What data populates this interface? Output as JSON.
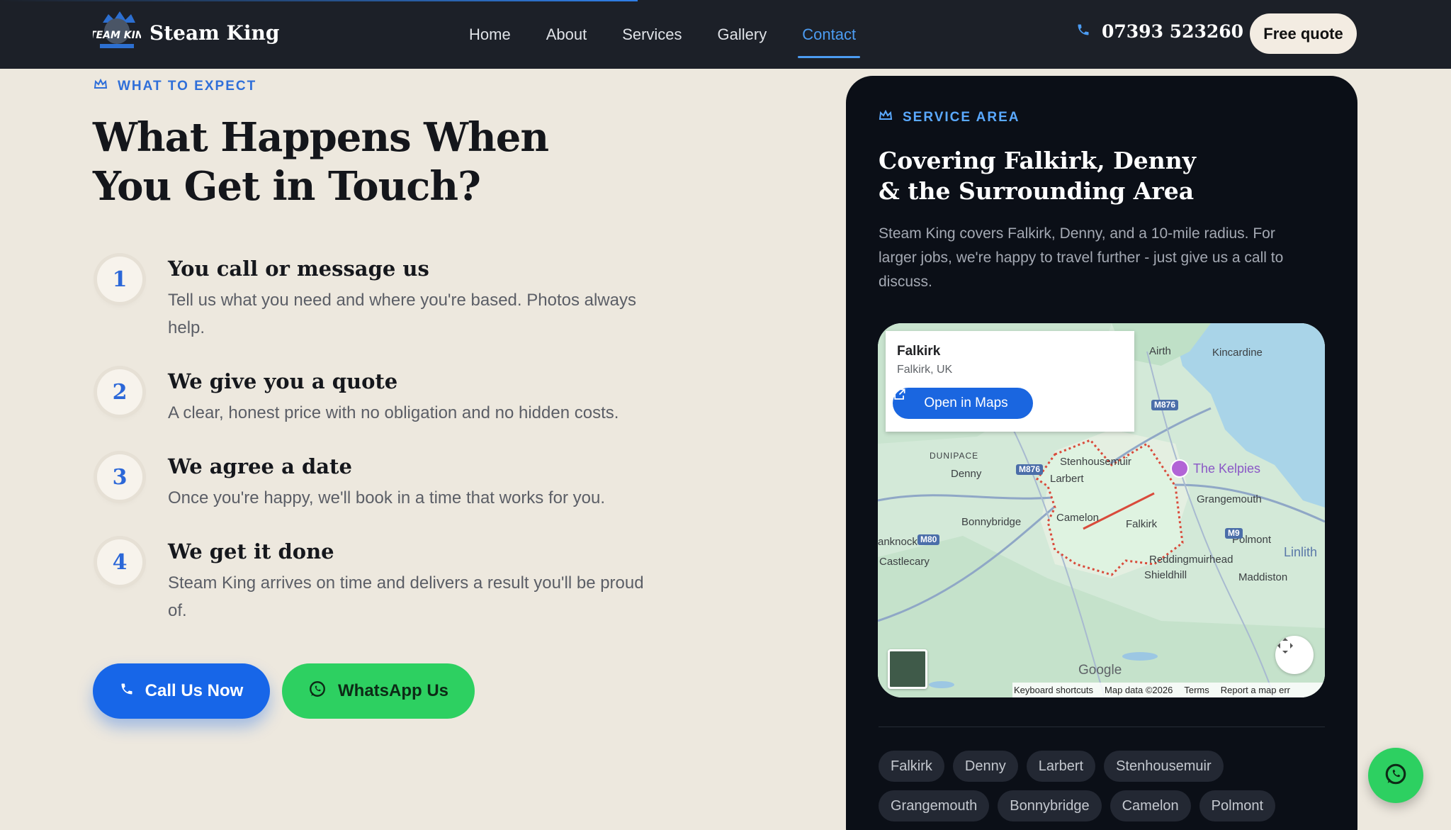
{
  "brand": {
    "name": "Steam King",
    "logo_text": "STEAM KING"
  },
  "nav": {
    "links": [
      "Home",
      "About",
      "Services",
      "Gallery",
      "Contact"
    ],
    "active": "Contact",
    "phone": "07393 523260",
    "quote_label": "Free quote"
  },
  "left": {
    "eyebrow": "WHAT TO EXPECT",
    "title_line1": "What Happens When",
    "title_line2": "You Get in Touch?",
    "steps": [
      {
        "num": "1",
        "title": "You call or message us",
        "desc": "Tell us what you need and where you're based. Photos always help."
      },
      {
        "num": "2",
        "title": "We give you a quote",
        "desc": "A clear, honest price with no obligation and no hidden costs."
      },
      {
        "num": "3",
        "title": "We agree a date",
        "desc": "Once you're happy, we'll book in a time that works for you."
      },
      {
        "num": "4",
        "title": "We get it done",
        "desc": "Steam King arrives on time and delivers a result you'll be proud of."
      }
    ],
    "call_label": "Call Us Now",
    "whatsapp_label": "WhatsApp Us"
  },
  "panel": {
    "eyebrow": "SERVICE AREA",
    "title_line1": "Covering Falkirk, Denny",
    "title_line2": "& the Surrounding Area",
    "desc": "Steam King covers Falkirk, Denny, and a 10-mile radius. For larger jobs, we're happy to travel further - just give us a call to discuss.",
    "map": {
      "place": "Falkirk",
      "place_sub": "Falkirk, UK",
      "open_label": "Open in Maps",
      "labels": [
        "Airth",
        "Kincardine",
        "DUNIPACE",
        "Denny",
        "Stenhousemuir",
        "Larbert",
        "Grangemouth",
        "Camelon",
        "Falkirk",
        "Bonnybridge",
        "Polmont",
        "anknock",
        "Castlecary",
        "Linlith",
        "Reddingmuirhead",
        "Shieldhill",
        "Maddiston"
      ],
      "roads": [
        "M876",
        "M876",
        "M80",
        "M9"
      ],
      "poi": "The Kelpies",
      "google": "Google",
      "attribution": [
        "Keyboard shortcuts",
        "Map data ©2026",
        "Terms",
        "Report a map err"
      ]
    },
    "chips": [
      "Falkirk",
      "Denny",
      "Larbert",
      "Stenhousemuir",
      "Grangemouth",
      "Bonnybridge",
      "Camelon",
      "Polmont"
    ]
  },
  "colors": {
    "accent_blue": "#1766e8",
    "whatsapp_green": "#2dd061",
    "nav_bg": "#1c2028",
    "panel_bg": "#0b0f17",
    "page_bg": "#ede8de"
  }
}
